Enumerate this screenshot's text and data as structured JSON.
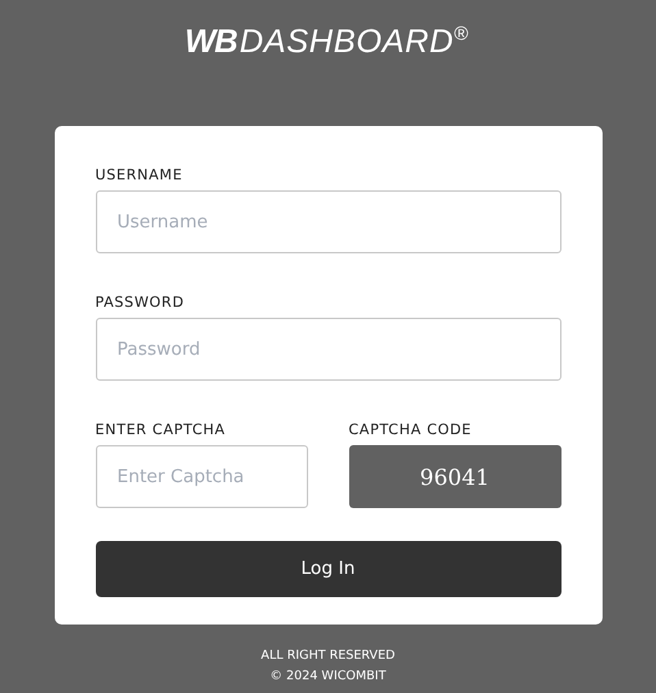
{
  "logo": "**WB**DASHBOARD$^{®}$",
  "fields": [
    {
      "label": "USERNAME",
      "placeholder": "Username"
    },
    {
      "label": "PASSWORD",
      "placeholder": "Password"
    }
  ],
  "captcha": {
    "label": "ENTER CAPTCHA",
    "placeholder": "Enter Captcha",
    "code_label": "CAPTCHA CODE",
    "code": "96041"
  },
  "button": "Log In",
  "footer": [
    "ALL RIGHT RESERVED",
    "© 2024 WICOMBIT"
  ]
}
